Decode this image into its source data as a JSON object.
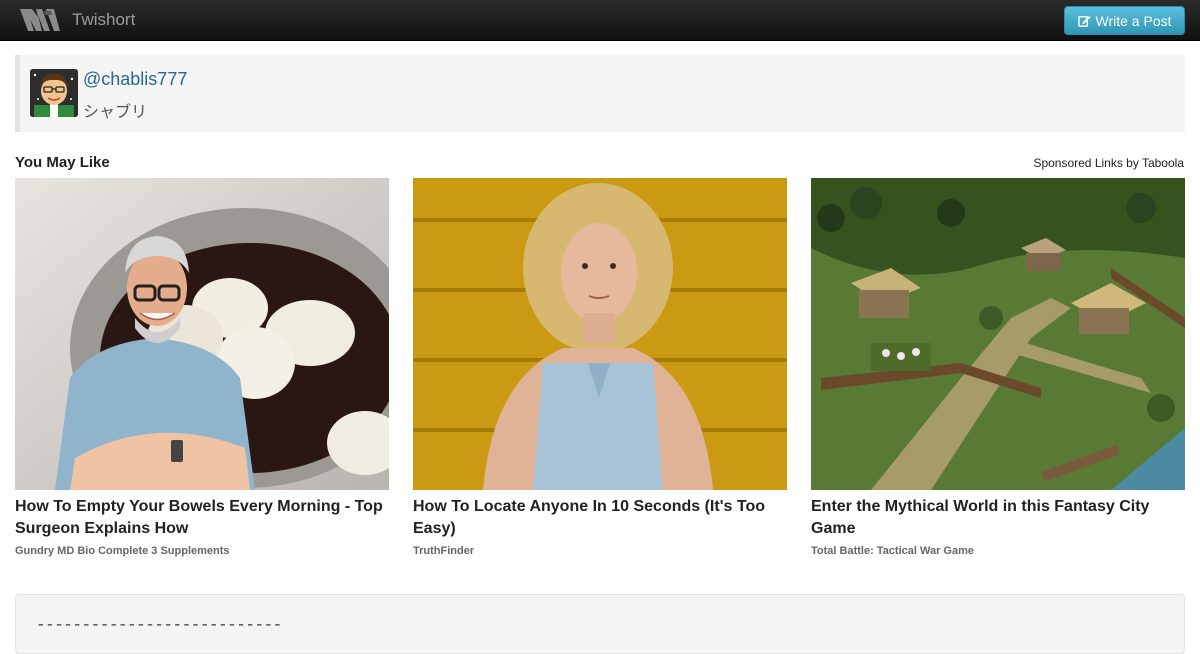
{
  "navbar": {
    "brand": "Twishort",
    "write_button": "Write a Post"
  },
  "profile": {
    "username": "@chablis777",
    "display_name": "シャブリ"
  },
  "recommendations": {
    "title": "You May Like",
    "sponsored_label": "Sponsored Links by Taboola",
    "items": [
      {
        "headline": "How To Empty Your Bowels Every Morning - Top Surgeon Explains How",
        "source": "Gundry MD Bio Complete 3 Supplements"
      },
      {
        "headline": "How To Locate Anyone In 10 Seconds (It's Too Easy)",
        "source": "TruthFinder"
      },
      {
        "headline": "Enter the Mythical World in this Fantasy City Game",
        "source": "Total Battle: Tactical War Game"
      }
    ]
  },
  "post": {
    "text": "---------------------------"
  },
  "colors": {
    "navbar": "#1b1b1b",
    "button": "#49afcd",
    "link": "#2a6496"
  }
}
